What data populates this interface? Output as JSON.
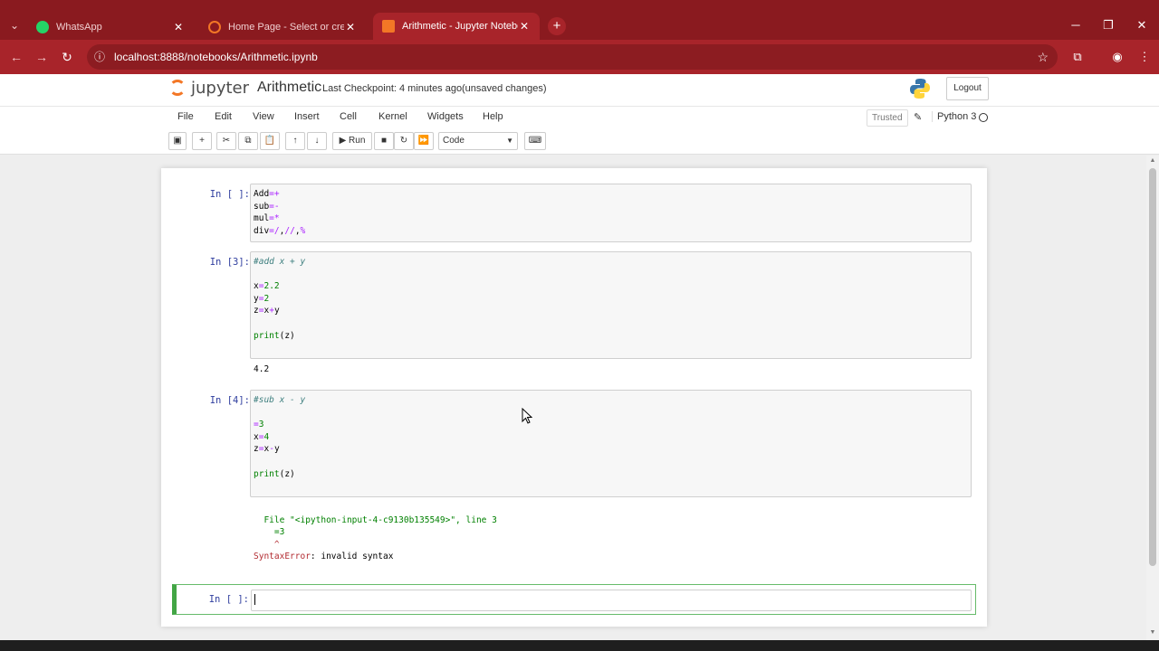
{
  "browser": {
    "tabs": [
      {
        "title": "WhatsApp",
        "active": false
      },
      {
        "title": "Home Page - Select or create a",
        "active": false
      },
      {
        "title": "Arithmetic - Jupyter Notebook",
        "active": true
      }
    ],
    "url": "localhost:8888/notebooks/Arithmetic.ipynb"
  },
  "header": {
    "logo_text": "jupyter",
    "notebook_name": "Arithmetic",
    "checkpoint": "Last Checkpoint: 4 minutes ago",
    "unsaved": "(unsaved changes)",
    "logout_label": "Logout"
  },
  "menubar": {
    "items": [
      "File",
      "Edit",
      "View",
      "Insert",
      "Cell",
      "Kernel",
      "Widgets",
      "Help"
    ],
    "trusted": "Trusted",
    "kernel": "Python 3"
  },
  "toolbar": {
    "run_label": "Run",
    "cell_type": "Code"
  },
  "cells": [
    {
      "prompt": "In [ ]:"
    },
    {
      "prompt": "In [3]:",
      "output": "4.2"
    },
    {
      "prompt": "In [4]:",
      "error_file": "  File \"<ipython-input-4-c9130b135549>\", line 3",
      "error_line": "    =3",
      "error_caret": "    ^",
      "error_name": "SyntaxError",
      "error_msg": ": invalid syntax"
    },
    {
      "prompt": "In [ ]:"
    }
  ],
  "colors": {
    "brand_red": "#a8242a",
    "jupyter_orange": "#f37726",
    "selected_cell": "#42a545"
  }
}
